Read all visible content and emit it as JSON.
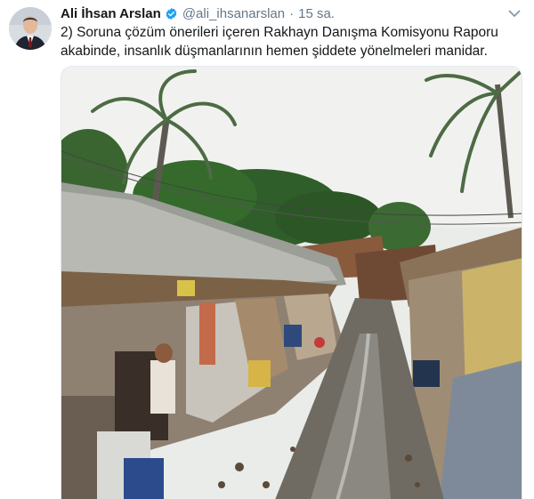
{
  "tweet": {
    "author_name": "Ali İhsan Arslan",
    "handle": "@ali_ihsanarslan",
    "separator": "·",
    "timestamp": "15 sa.",
    "text": "2) Soruna çözüm önerileri içeren Rakhayn Danışma Komisyonu Raporu\nakabinde, insanlık düşmanlarının hemen şiddete yönelmeleri manidar."
  },
  "icons": {
    "verified": "verified-badge-icon",
    "menu": "chevron-down-icon"
  },
  "colors": {
    "text": "#14171a",
    "muted": "#657786",
    "verified": "#1da1f2",
    "border": "#e1e8ed"
  }
}
